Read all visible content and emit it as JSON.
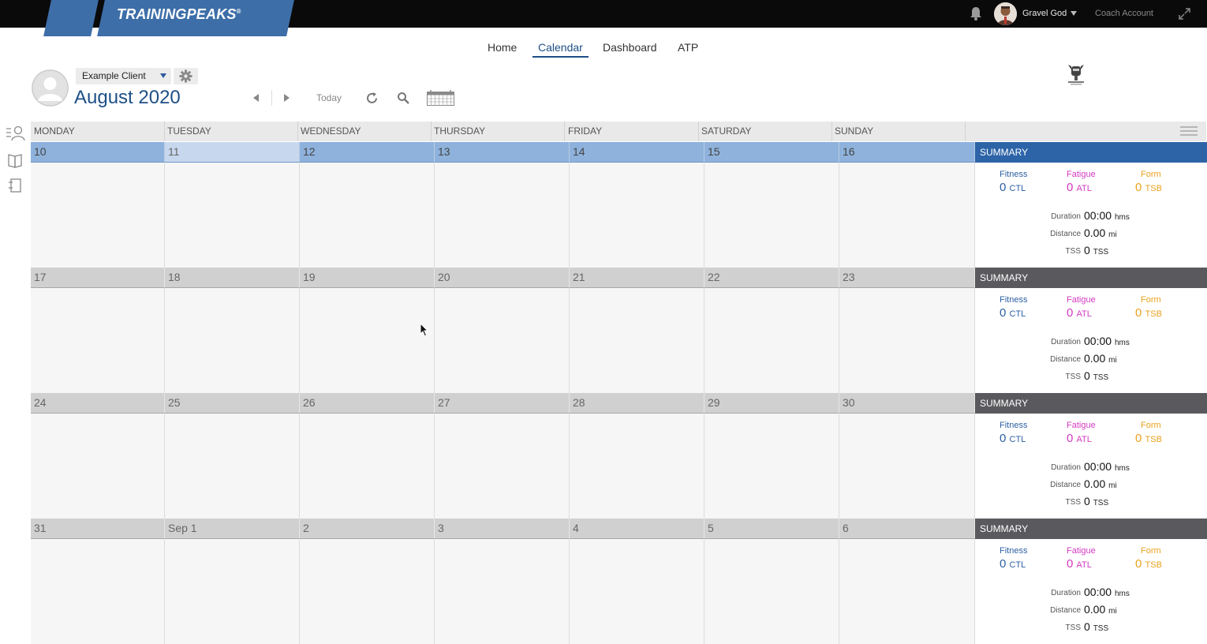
{
  "topbar": {
    "logo_text": "TRAININGPEAKS",
    "logo_trademark": "®",
    "user_name": "Gravel God",
    "coach_link": "Coach Account"
  },
  "nav": {
    "items": [
      "Home",
      "Calendar",
      "Dashboard",
      "ATP"
    ],
    "active": "Calendar"
  },
  "header": {
    "client_name": "Example Client",
    "month_title": "August 2020",
    "today_label": "Today"
  },
  "calendar": {
    "weekdays": [
      "MONDAY",
      "TUESDAY",
      "WEDNESDAY",
      "THURSDAY",
      "FRIDAY",
      "SATURDAY",
      "SUNDAY"
    ],
    "weeks": [
      {
        "days": [
          "10",
          "11",
          "12",
          "13",
          "14",
          "15",
          "16"
        ],
        "current": true,
        "today_index": 1
      },
      {
        "days": [
          "17",
          "18",
          "19",
          "20",
          "21",
          "22",
          "23"
        ],
        "current": false
      },
      {
        "days": [
          "24",
          "25",
          "26",
          "27",
          "28",
          "29",
          "30"
        ],
        "current": false
      },
      {
        "days": [
          "31",
          "Sep 1",
          "2",
          "3",
          "4",
          "5",
          "6"
        ],
        "current": false
      }
    ]
  },
  "summary": {
    "title": "SUMMARY",
    "fitness_label": "Fitness",
    "fatigue_label": "Fatigue",
    "form_label": "Form",
    "fitness_value": "0",
    "fatigue_value": "0",
    "form_value": "0",
    "ctl_unit": "CTL",
    "atl_unit": "ATL",
    "tsb_unit": "TSB",
    "duration_label": "Duration",
    "duration_value": "00:00",
    "duration_unit": "hms",
    "distance_label": "Distance",
    "distance_value": "0.00",
    "distance_unit": "mi",
    "tss_label": "TSS",
    "tss_value": "0",
    "tss_unit": "TSS"
  },
  "colors": {
    "brand_blue": "#1e4f87",
    "current_week_bar": "#8eb2dc",
    "summary_current": "#2d64a8",
    "summary_normal": "#5a5a5e",
    "fitness": "#2c5fa3",
    "fatigue": "#d43ac0",
    "form": "#e8a21e"
  },
  "icons": [
    "bell-icon",
    "user-caret-icon",
    "expand-icon",
    "gear-icon",
    "refresh-icon",
    "search-icon",
    "calendar-icon",
    "athlete-icon",
    "library-icon",
    "notes-icon",
    "menu-icon"
  ]
}
